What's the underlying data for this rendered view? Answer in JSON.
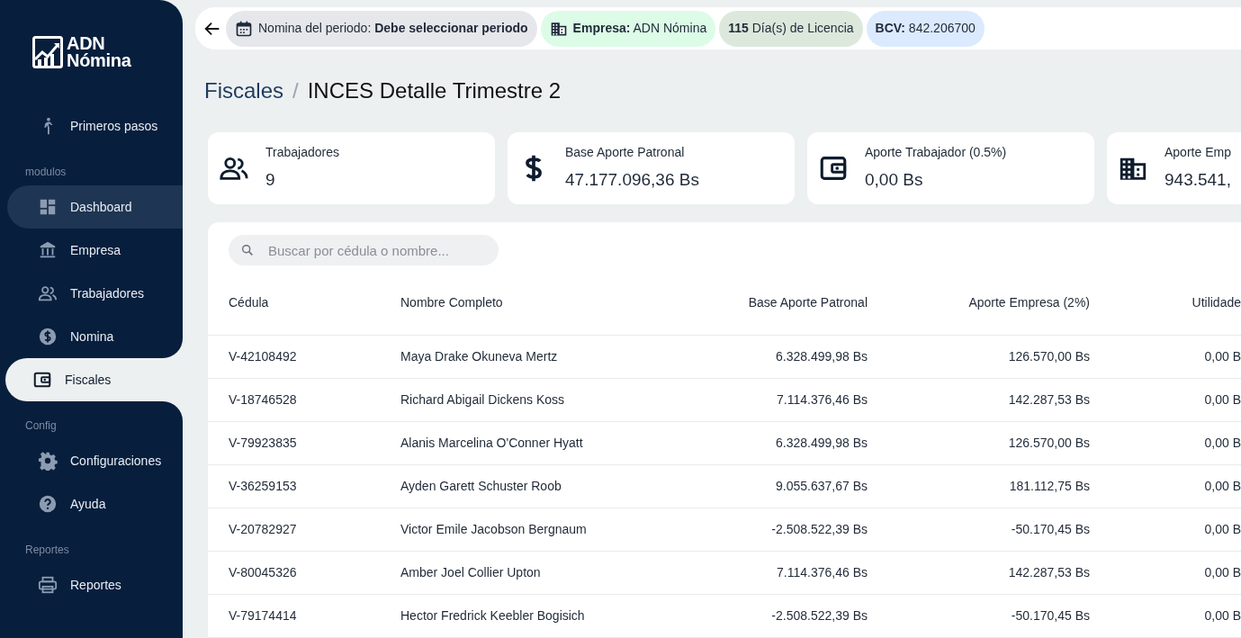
{
  "brand": {
    "line1": "ADN",
    "line2": "Nómina"
  },
  "sidebar": {
    "items": [
      {
        "kind": "item",
        "label": "Primeros pasos",
        "selected": false,
        "highlighted": false
      },
      {
        "kind": "section",
        "label": "modulos"
      },
      {
        "kind": "item",
        "label": "Dashboard",
        "selected": false,
        "highlighted": true
      },
      {
        "kind": "item",
        "label": "Empresa",
        "selected": false,
        "highlighted": false
      },
      {
        "kind": "item",
        "label": "Trabajadores",
        "selected": false,
        "highlighted": false
      },
      {
        "kind": "item",
        "label": "Nomina",
        "selected": false,
        "highlighted": false
      },
      {
        "kind": "item",
        "label": "Fiscales",
        "selected": true,
        "highlighted": false
      },
      {
        "kind": "section",
        "label": "Config"
      },
      {
        "kind": "item",
        "label": "Configuraciones",
        "selected": false,
        "highlighted": false
      },
      {
        "kind": "item",
        "label": "Ayuda",
        "selected": false,
        "highlighted": false
      },
      {
        "kind": "section",
        "label": "Reportes"
      },
      {
        "kind": "item",
        "label": "Reportes",
        "selected": false,
        "highlighted": false
      }
    ]
  },
  "topbar": {
    "chips": [
      {
        "kind": "calendar",
        "text": "Nomina del periodo: **Debe seleccionar periodo**",
        "color": "#e5e7eb"
      },
      {
        "kind": "building",
        "text": "**Empresa:** ADN Nómina",
        "color": "#dcfce7"
      },
      {
        "kind": "plain",
        "text": "**115** Día(s) de Licencia",
        "color": "#dce8dc"
      },
      {
        "kind": "plain",
        "text": "**BCV:** 842.206700",
        "color": "#dbeafe"
      }
    ]
  },
  "breadcrumb": {
    "parent": "Fiscales",
    "separator": "/",
    "current": "INCES Detalle Trimestre 2"
  },
  "stats": [
    {
      "label": "Trabajadores",
      "value": "9"
    },
    {
      "label": "Base Aporte Patronal",
      "value": "47.177.096,36 Bs"
    },
    {
      "label": "Aporte Trabajador (0.5%)",
      "value": "0,00 Bs"
    },
    {
      "label": "Aporte Emp",
      "value": "943.541,"
    }
  ],
  "search": {
    "placeholder": "Buscar por cédula o nombre..."
  },
  "table": {
    "columns": [
      "Cédula",
      "Nombre Completo",
      "Base Aporte Patronal",
      "Aporte Empresa (2%)",
      "Utilidade"
    ],
    "rows": [
      [
        "V-42108492",
        "Maya Drake Okuneva Mertz",
        "6.328.499,98 Bs",
        "126.570,00 Bs",
        "0,00 B"
      ],
      [
        "V-18746528",
        "Richard Abigail Dickens Koss",
        "7.114.376,46 Bs",
        "142.287,53 Bs",
        "0,00 B"
      ],
      [
        "V-79923835",
        "Alanis Marcelina O'Conner Hyatt",
        "6.328.499,98 Bs",
        "126.570,00 Bs",
        "0,00 B"
      ],
      [
        "V-36259153",
        "Ayden Garett Schuster Roob",
        "9.055.637,67 Bs",
        "181.112,75 Bs",
        "0,00 B"
      ],
      [
        "V-20782927",
        "Victor Emile Jacobson Bergnaum",
        "-2.508.522,39 Bs",
        "-50.170,45 Bs",
        "0,00 B"
      ],
      [
        "V-80045326",
        "Amber Joel Collier Upton",
        "7.114.376,46 Bs",
        "142.287,53 Bs",
        "0,00 B"
      ],
      [
        "V-79174414",
        "Hector Fredrick Keebler Bogisich",
        "-2.508.522,39 Bs",
        "-50.170,45 Bs",
        "0,00 B"
      ]
    ]
  }
}
